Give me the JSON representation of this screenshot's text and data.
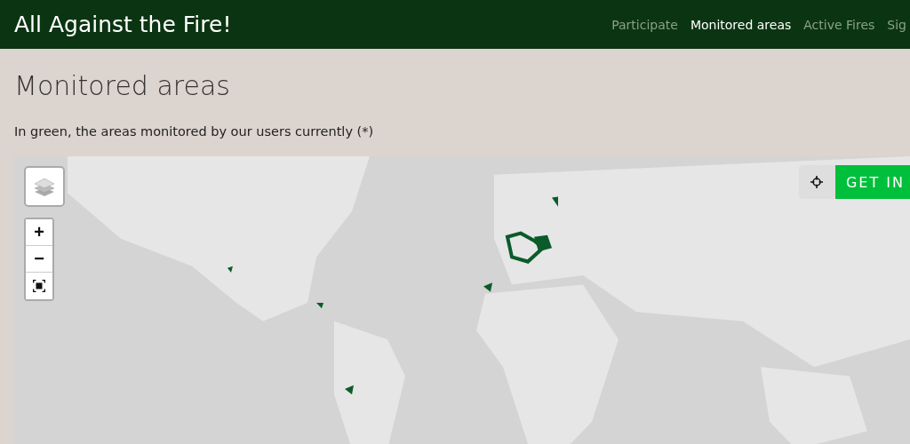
{
  "header": {
    "title": "All Against the Fire!"
  },
  "nav": [
    {
      "label": "Participate",
      "selected": false
    },
    {
      "label": "Monitored areas",
      "selected": true
    },
    {
      "label": "Active Fires",
      "selected": false
    },
    {
      "label": "Sig",
      "selected": false
    }
  ],
  "page": {
    "heading": "Monitored areas",
    "intro": "In green, the areas monitored by our users currently (*)"
  },
  "map": {
    "zoom_in": "+",
    "zoom_out": "−",
    "cta_button": "GET IN"
  }
}
